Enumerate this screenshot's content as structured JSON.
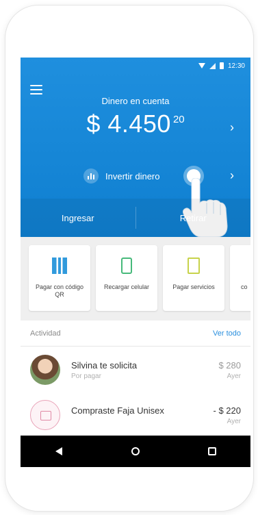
{
  "status_bar": {
    "time": "12:30"
  },
  "header": {
    "balance_label": "Dinero en cuenta",
    "balance_main": "$ 4.450",
    "balance_cents": "20",
    "invest_label": "Invertir dinero",
    "chevron": "›"
  },
  "actions": {
    "deposit": "Ingresar",
    "withdraw": "Retirar"
  },
  "shortcuts": [
    {
      "label": "Pagar con código QR",
      "icon": "qr-code-icon",
      "color": "#1a8fd8"
    },
    {
      "label": "Recargar celular",
      "icon": "phone-recharge-icon",
      "color": "#46b97a"
    },
    {
      "label": "Pagar servicios",
      "icon": "bill-icon",
      "color": "#c7d24a"
    },
    {
      "label": "co",
      "icon": ""
    }
  ],
  "activity": {
    "title": "Actividad",
    "see_all": "Ver todo",
    "items": [
      {
        "title": "Silvina te solicita",
        "subtitle": "Por pagar",
        "amount": "$ 280",
        "date": "Ayer",
        "icon": "avatar-photo"
      },
      {
        "title": "Compraste Faja Unisex",
        "subtitle": "",
        "amount": "- $ 220",
        "date": "Ayer",
        "icon": "shopping-bag-icon"
      }
    ]
  },
  "colors": {
    "primary": "#1f8fde",
    "link": "#2a8fde",
    "navbar": "#000000"
  }
}
